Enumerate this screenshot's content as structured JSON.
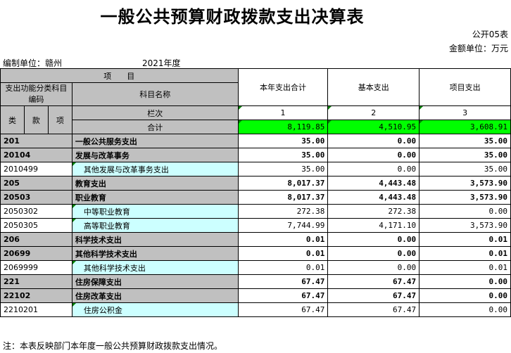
{
  "title": "一般公共预算财政拨款支出决算表",
  "doc_no": "公开05表",
  "unit": "金额单位：万元",
  "compiler": "编制单位：赣州",
  "year": "2021年度",
  "headers": {
    "item": "项　　目",
    "code_label": "支出功能分类科目编码",
    "name_label": "科目名称",
    "col_total": "本年支出合计",
    "col_basic": "基本支出",
    "col_project": "项目支出",
    "lei": "类",
    "kuan": "款",
    "xiang": "项",
    "lanci": "栏次",
    "idx1": "1",
    "idx2": "2",
    "idx3": "3",
    "total_label": "合计",
    "total_1": "8,119.85",
    "total_2": "4,510.95",
    "total_3": "3,608.91"
  },
  "rows": [
    {
      "code": "201",
      "name": "一般公共服务支出",
      "v1": "35.00",
      "v2": "0.00",
      "v3": "35.00",
      "level": "lei"
    },
    {
      "code": "20104",
      "name": "发展与改革事务",
      "v1": "35.00",
      "v2": "0.00",
      "v3": "35.00",
      "level": "kuan"
    },
    {
      "code": "2010499",
      "name": "其他发展与改革事务支出",
      "v1": "35.00",
      "v2": "0.00",
      "v3": "35.00",
      "level": "xiang"
    },
    {
      "code": "205",
      "name": "教育支出",
      "v1": "8,017.37",
      "v2": "4,443.48",
      "v3": "3,573.90",
      "level": "lei"
    },
    {
      "code": "20503",
      "name": "职业教育",
      "v1": "8,017.37",
      "v2": "4,443.48",
      "v3": "3,573.90",
      "level": "kuan"
    },
    {
      "code": "2050302",
      "name": "中等职业教育",
      "v1": "272.38",
      "v2": "272.38",
      "v3": "0.00",
      "level": "xiang"
    },
    {
      "code": "2050305",
      "name": "高等职业教育",
      "v1": "7,744.99",
      "v2": "4,171.10",
      "v3": "3,573.90",
      "level": "xiang"
    },
    {
      "code": "206",
      "name": "科学技术支出",
      "v1": "0.01",
      "v2": "0.00",
      "v3": "0.01",
      "level": "lei"
    },
    {
      "code": "20699",
      "name": "其他科学技术支出",
      "v1": "0.01",
      "v2": "0.00",
      "v3": "0.01",
      "level": "kuan"
    },
    {
      "code": "2069999",
      "name": "其他科学技术支出",
      "v1": "0.01",
      "v2": "0.00",
      "v3": "0.01",
      "level": "xiang"
    },
    {
      "code": "221",
      "name": "住房保障支出",
      "v1": "67.47",
      "v2": "67.47",
      "v3": "0.00",
      "level": "lei"
    },
    {
      "code": "22102",
      "name": "住房改革支出",
      "v1": "67.47",
      "v2": "67.47",
      "v3": "0.00",
      "level": "kuan"
    },
    {
      "code": "2210201",
      "name": "住房公积金",
      "v1": "67.47",
      "v2": "67.47",
      "v3": "0.00",
      "level": "xiang"
    }
  ],
  "footnote": "注：本表反映部门本年度一般公共预算财政拨款支出情况。",
  "colors": {
    "header_gray": "#c0c0c0",
    "total_green": "#00ff00",
    "name_cyan": "#ccffff"
  }
}
